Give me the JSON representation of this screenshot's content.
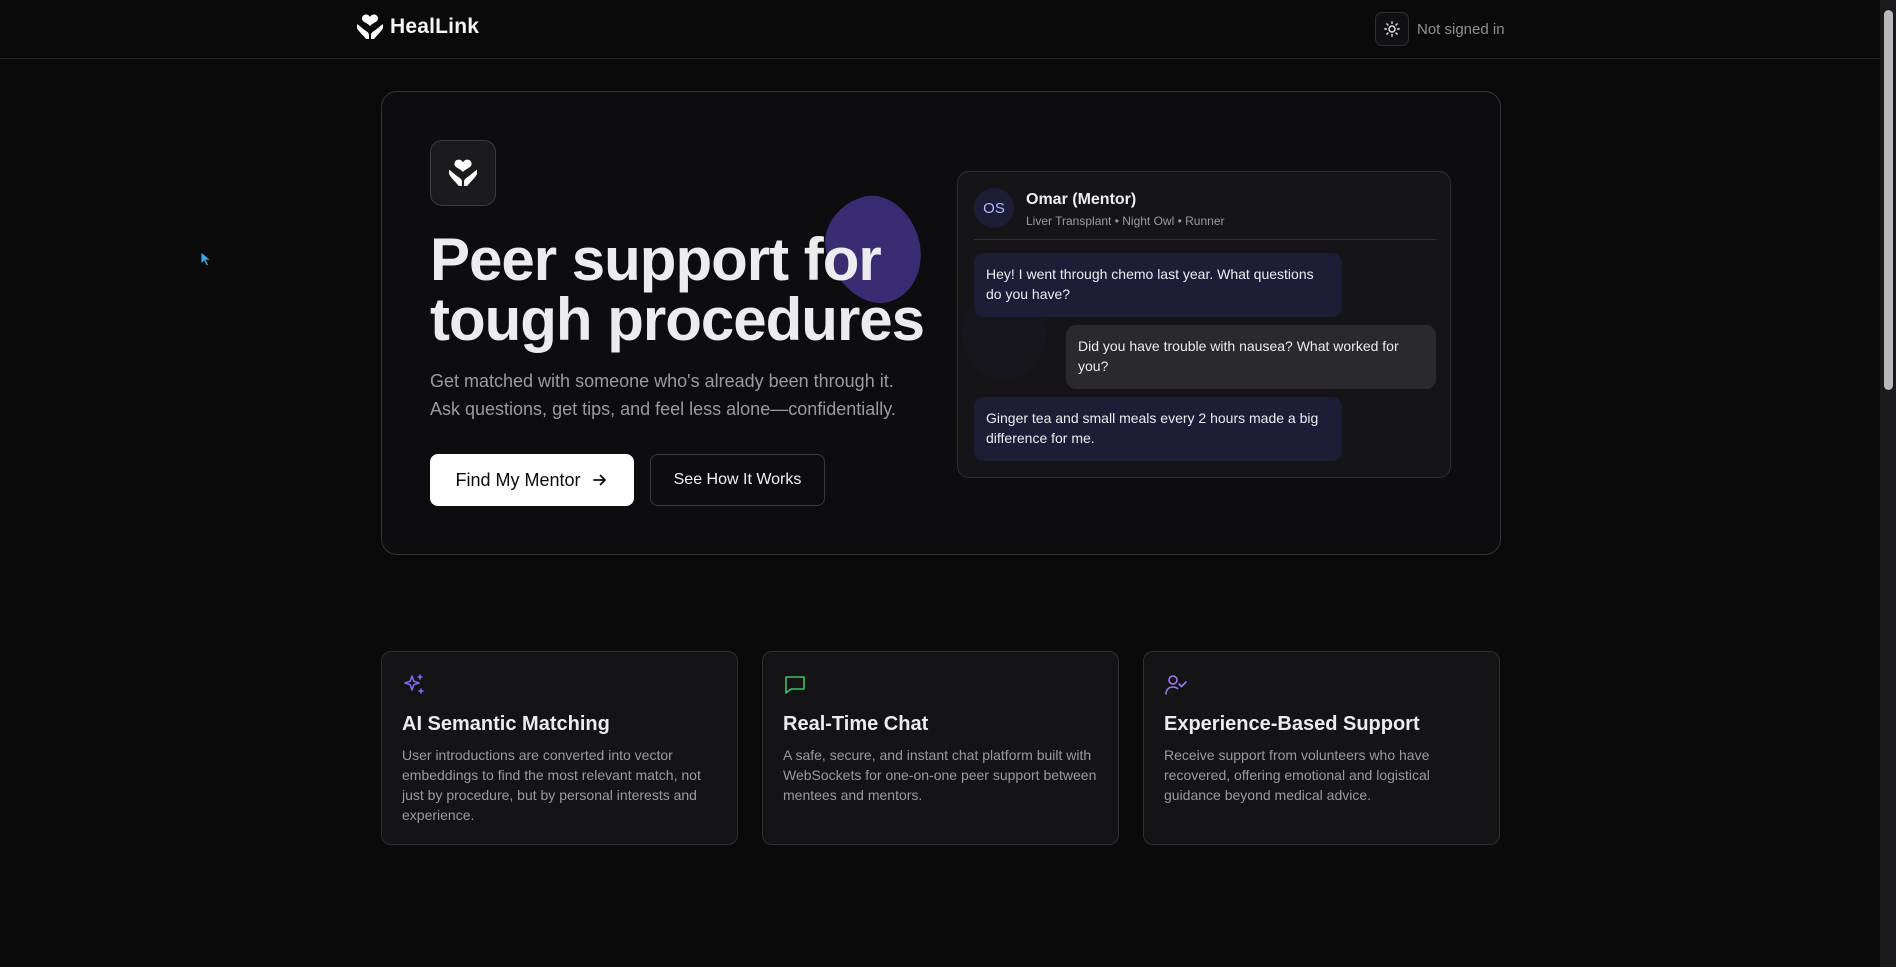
{
  "brand": {
    "name": "HealLink"
  },
  "header": {
    "signin_status": "Not signed in"
  },
  "hero": {
    "title": "Peer support for tough procedures",
    "subtitle": "Get matched with someone who's already been through it. Ask questions, get tips, and feel less alone—confidentially.",
    "primary_button": "Find My Mentor",
    "secondary_button": "See How It Works"
  },
  "chat_preview": {
    "avatar_initials": "OS",
    "mentor_name": "Omar (Mentor)",
    "mentor_tags": "Liver Transplant • Night Owl • Runner",
    "messages": [
      {
        "from": "mentor",
        "text": "Hey! I went through chemo last year. What questions do you have?"
      },
      {
        "from": "user",
        "text": "Did you have trouble with nausea? What worked for you?"
      },
      {
        "from": "mentor",
        "text": "Ginger tea and small meals every 2 hours made a big difference for me."
      }
    ]
  },
  "features": [
    {
      "icon": "sparkles-icon",
      "title": "AI Semantic Matching",
      "description": "User introductions are converted into vector embeddings to find the most relevant match, not just by procedure, but by personal interests and experience."
    },
    {
      "icon": "chat-bubble-icon",
      "title": "Real-Time Chat",
      "description": "A safe, secure, and instant chat platform built with WebSockets for one-on-one peer support between mentees and mentors."
    },
    {
      "icon": "user-check-icon",
      "title": "Experience-Based Support",
      "description": "Receive support from volunteers who have recovered, offering emotional and logistical guidance beyond medical advice."
    }
  ],
  "colors": {
    "background": "#0a0a0b",
    "accent_purple": "#7c6cf2",
    "accent_green": "#3fbf6f",
    "mentor_bubble": "#1e1d38",
    "user_bubble": "#2a2a2d"
  }
}
